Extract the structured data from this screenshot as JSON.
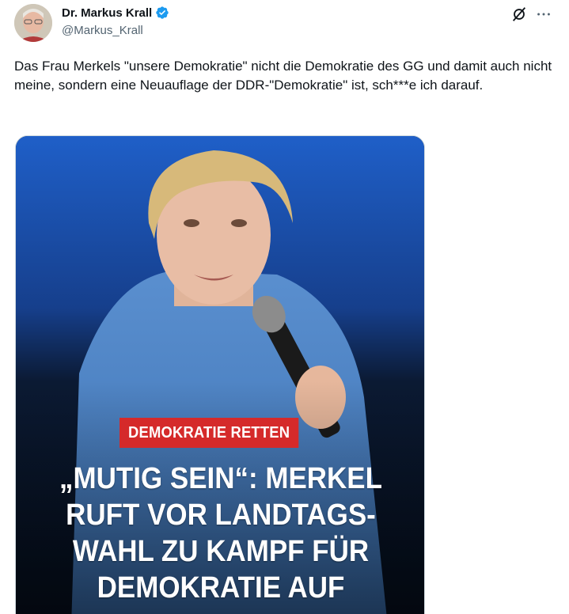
{
  "author": {
    "display_name": "Dr. Markus Krall",
    "handle": "@Markus_Krall",
    "verified_icon": "verified-badge-icon",
    "verified_color": "#1d9bf0"
  },
  "post": {
    "text": "Das Frau Merkels \"unsere Demokratie\" nicht die Demokratie des GG und damit auch nicht meine, sondern eine Neuauflage der DDR-\"Demokratie\" ist, sch***e ich darauf."
  },
  "media": {
    "tag_label": "DEMOKRATIE RETTEN",
    "tag_color": "#d52a2a",
    "headline_lines": [
      "„MUTIG SEIN“: MERKEL",
      "RUFT VOR LANDTAGS-",
      "WAHL ZU KAMPF FÜR",
      "DEMOKRATIE AUF"
    ]
  },
  "actions": {
    "grok_icon": "grok-icon",
    "more_icon": "more-options-icon"
  }
}
